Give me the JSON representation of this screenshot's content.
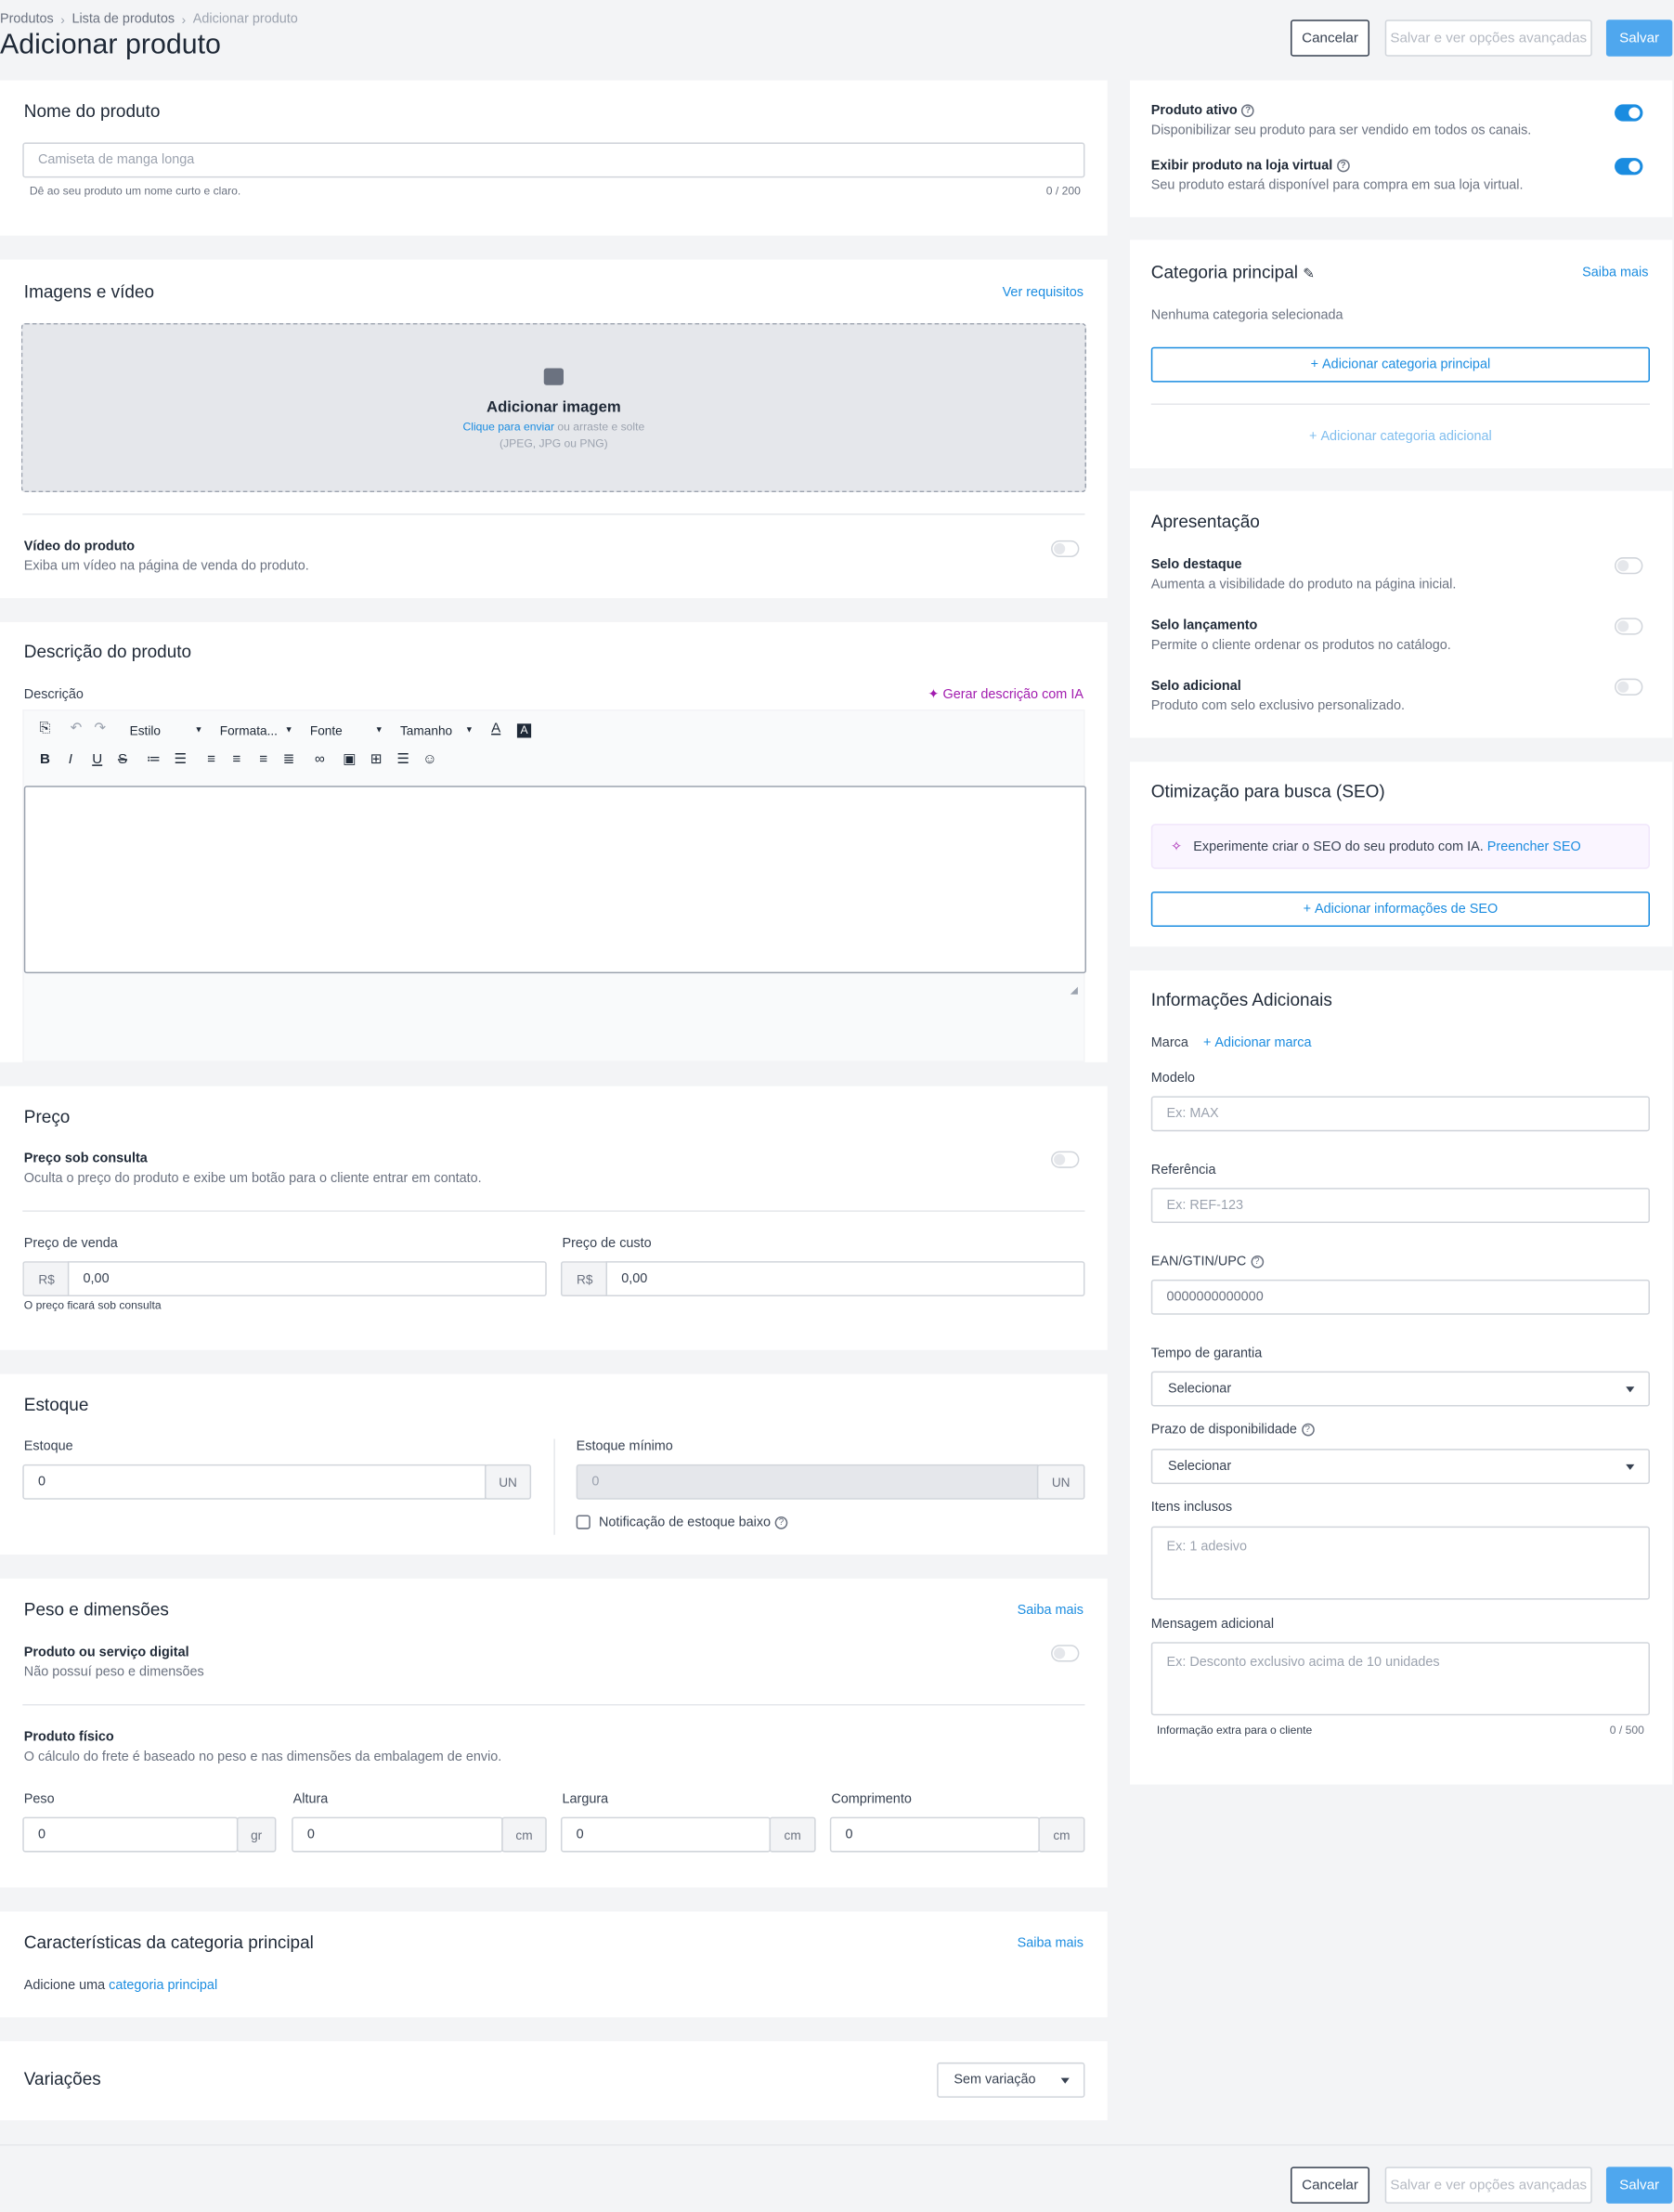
{
  "breadcrumb": {
    "items": [
      "Produtos",
      "Lista de produtos",
      "Adicionar produto"
    ]
  },
  "page": {
    "title": "Adicionar produto"
  },
  "actions": {
    "cancel": "Cancelar",
    "advanced": "Salvar e ver opções avançadas",
    "save": "Salvar"
  },
  "name_card": {
    "title": "Nome do produto",
    "placeholder": "Camiseta de manga longa",
    "hint": "Dê ao seu produto um nome curto e claro.",
    "counter": "0 / 200"
  },
  "media_card": {
    "title": "Imagens e vídeo",
    "requirements": "Ver requisitos",
    "add_image": "Adicionar imagem",
    "click_upload": "Clique para enviar",
    "drag": " ou arraste e solte",
    "formats": "(JPEG, JPG ou PNG)",
    "video_title": "Vídeo do produto",
    "video_desc": "Exiba um vídeo na página de venda do produto."
  },
  "desc_card": {
    "title": "Descrição do produto",
    "label": "Descrição",
    "ai": "Gerar descrição com IA",
    "toolbar": {
      "style": "Estilo",
      "format": "Formata...",
      "font": "Fonte",
      "size": "Tamanho"
    }
  },
  "price_card": {
    "title": "Preço",
    "consult_title": "Preço sob consulta",
    "consult_desc": "Oculta o preço do produto e exibe um botão para o cliente entrar em contato.",
    "sale_label": "Preço de venda",
    "cost_label": "Preço de custo",
    "currency": "R$",
    "sale_value": "0,00",
    "cost_value": "0,00",
    "hint": "O preço ficará sob consulta"
  },
  "stock_card": {
    "title": "Estoque",
    "stock_label": "Estoque",
    "stock_value": "0",
    "unit": "UN",
    "min_label": "Estoque mínimo",
    "min_value": "0",
    "notify": "Notificação de estoque baixo"
  },
  "weight_card": {
    "title": "Peso e dimensões",
    "learn_more": "Saiba mais",
    "digital_title": "Produto ou serviço digital",
    "digital_desc": "Não possuí peso e dimensões",
    "physical_title": "Produto físico",
    "physical_desc": "O cálculo do frete é baseado no peso e nas dimensões da embalagem de envio.",
    "fields": [
      {
        "label": "Peso",
        "value": "0",
        "unit": "gr"
      },
      {
        "label": "Altura",
        "value": "0",
        "unit": "cm"
      },
      {
        "label": "Largura",
        "value": "0",
        "unit": "cm"
      },
      {
        "label": "Comprimento",
        "value": "0",
        "unit": "cm"
      }
    ]
  },
  "features_card": {
    "title": "Características da categoria principal",
    "learn_more": "Saiba mais",
    "text": "Adicione uma ",
    "link": "categoria principal"
  },
  "variations_card": {
    "title": "Variações",
    "select": "Sem variação"
  },
  "status_card": {
    "active_title": "Produto ativo",
    "active_desc": "Disponibilizar seu produto para ser vendido em todos os canais.",
    "store_title": "Exibir produto na loja virtual",
    "store_desc": "Seu produto estará disponível para compra em sua loja virtual.",
    "active_on": true,
    "store_on": true
  },
  "category_card": {
    "title": "Categoria principal",
    "learn_more": "Saiba mais",
    "none": "Nenhuma categoria selecionada",
    "add_main": "Adicionar categoria principal",
    "add_extra": "Adicionar categoria adicional"
  },
  "presentation_card": {
    "title": "Apresentação",
    "items": [
      {
        "title": "Selo destaque",
        "desc": "Aumenta a visibilidade do produto na página inicial."
      },
      {
        "title": "Selo lançamento",
        "desc": "Permite o cliente ordenar os produtos no catálogo."
      },
      {
        "title": "Selo adicional",
        "desc": "Produto com selo exclusivo personalizado."
      }
    ]
  },
  "seo_card": {
    "title": "Otimização para busca (SEO)",
    "banner": "Experimente criar o SEO do seu produto com IA.",
    "banner_link": "Preencher SEO",
    "add": "Adicionar informações de SEO"
  },
  "extra_card": {
    "title": "Informações Adicionais",
    "brand_label": "Marca",
    "brand_add": "Adicionar marca",
    "model_label": "Modelo",
    "model_ph": "Ex: MAX",
    "ref_label": "Referência",
    "ref_ph": "Ex: REF-123",
    "ean_label": "EAN/GTIN/UPC",
    "ean_ph": "0000000000000",
    "warranty_label": "Tempo de garantia",
    "warranty_value": "Selecionar",
    "avail_label": "Prazo de disponibilidade",
    "avail_value": "Selecionar",
    "items_label": "Itens inclusos",
    "items_ph": "Ex: 1 adesivo",
    "msg_label": "Mensagem adicional",
    "msg_ph": "Ex: Desconto exclusivo acima de 10 unidades",
    "msg_hint": "Informação extra para o cliente",
    "msg_counter": "0 / 500"
  },
  "colors": {
    "accent": "#1a8ce0",
    "save": "#4fa7ee",
    "ai": "#a21caf"
  }
}
